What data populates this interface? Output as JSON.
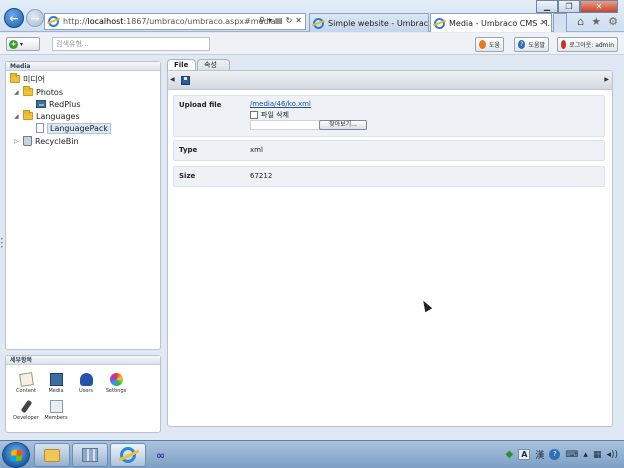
{
  "browser": {
    "address_host": "http://",
    "address_bold": "localhost",
    "address_rest": ":1867/umbraco/umbraco.aspx#media",
    "tabs": [
      {
        "label": "Simple website - Umbraco C..."
      },
      {
        "label": "Media - Umbraco CMS - l..."
      }
    ],
    "win_min": "▁",
    "win_max": "❐",
    "win_close": "✕"
  },
  "topbar": {
    "search_placeholder": "검색유형...",
    "help_label": "도움",
    "about_label": "도움말",
    "logout_label": "로그아웃: admin"
  },
  "tree": {
    "header": "Media",
    "root": "미디어",
    "items": [
      {
        "label": "Photos"
      },
      {
        "label": "RedPlus"
      },
      {
        "label": "Languages"
      },
      {
        "label": "LanguagePack"
      },
      {
        "label": "RecycleBin"
      }
    ]
  },
  "sections": {
    "header": "세부항목",
    "items": [
      {
        "label": "Content"
      },
      {
        "label": "Media"
      },
      {
        "label": "Users"
      },
      {
        "label": "Settings"
      },
      {
        "label": "Developer"
      },
      {
        "label": "Members"
      }
    ]
  },
  "editor": {
    "tabs": [
      {
        "label": "File"
      },
      {
        "label": "속성"
      }
    ],
    "upload_label": "Upload file",
    "file_link": "/media/46/ko.xml",
    "delete_label": "파일 삭제",
    "browse_label": "찾아보기...",
    "type_label": "Type",
    "type_value": "xml",
    "size_label": "Size",
    "size_value": "67212"
  },
  "colors": {
    "accent": "#1a4fa8",
    "chrome": "#cfdff1"
  }
}
